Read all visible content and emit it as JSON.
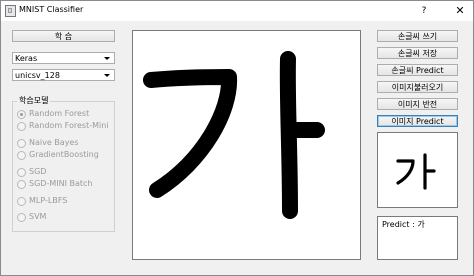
{
  "window": {
    "title": "MNIST Classifier",
    "help_glyph": "?",
    "close_glyph": "✕"
  },
  "left_panel": {
    "learn_button": "학 습",
    "framework_select": "Keras",
    "model_select": "unicsv_128",
    "group_title": "학습모델",
    "models": [
      {
        "label": "Random Forest",
        "checked": true
      },
      {
        "label": "Random Forest-Mini",
        "checked": false
      },
      {
        "label": "Naive Bayes",
        "checked": false
      },
      {
        "label": "GradientBoosting",
        "checked": false
      },
      {
        "label": "SGD",
        "checked": false
      },
      {
        "label": "SGD-MINI Batch",
        "checked": false
      },
      {
        "label": "MLP-LBFS",
        "checked": false
      },
      {
        "label": "SVM",
        "checked": false
      }
    ]
  },
  "right_panel": {
    "buttons": [
      "손글씨 쓰기",
      "손글씨 저장",
      "손글씨 Predict",
      "이미지불러오기",
      "이미지 반전",
      "이미지 Predict"
    ],
    "preview_char": "가",
    "result_text": "Predict : 가"
  },
  "icons": {
    "app": "app-window-icon",
    "dropdown": "chevron-down-icon"
  }
}
